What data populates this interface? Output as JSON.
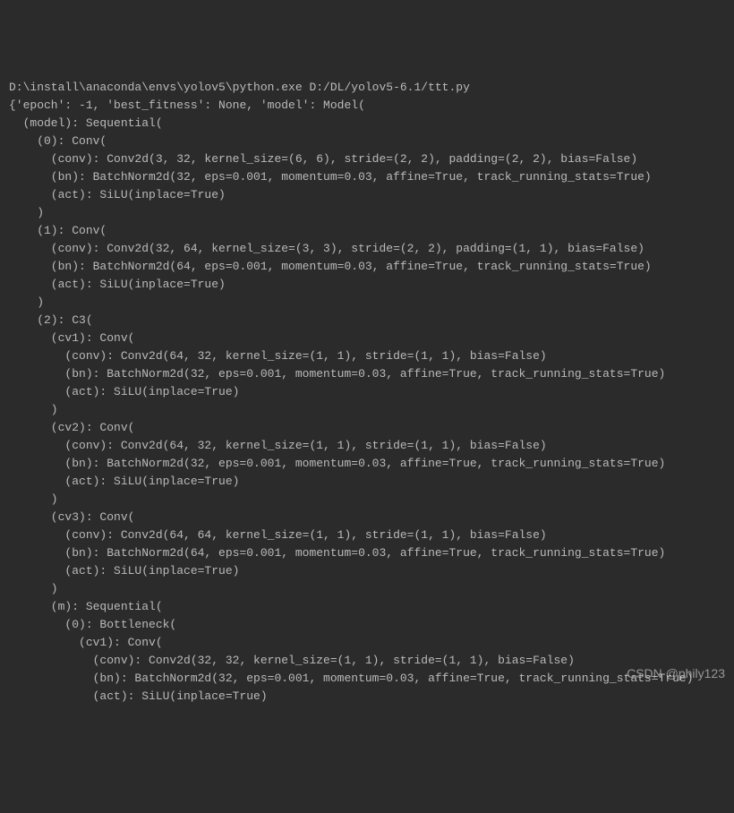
{
  "lines": [
    "D:\\install\\anaconda\\envs\\yolov5\\python.exe D:/DL/yolov5-6.1/ttt.py",
    "{'epoch': -1, 'best_fitness': None, 'model': Model(",
    "  (model): Sequential(",
    "    (0): Conv(",
    "      (conv): Conv2d(3, 32, kernel_size=(6, 6), stride=(2, 2), padding=(2, 2), bias=False)",
    "      (bn): BatchNorm2d(32, eps=0.001, momentum=0.03, affine=True, track_running_stats=True)",
    "      (act): SiLU(inplace=True)",
    "    )",
    "    (1): Conv(",
    "      (conv): Conv2d(32, 64, kernel_size=(3, 3), stride=(2, 2), padding=(1, 1), bias=False)",
    "      (bn): BatchNorm2d(64, eps=0.001, momentum=0.03, affine=True, track_running_stats=True)",
    "      (act): SiLU(inplace=True)",
    "    )",
    "    (2): C3(",
    "      (cv1): Conv(",
    "        (conv): Conv2d(64, 32, kernel_size=(1, 1), stride=(1, 1), bias=False)",
    "        (bn): BatchNorm2d(32, eps=0.001, momentum=0.03, affine=True, track_running_stats=True)",
    "        (act): SiLU(inplace=True)",
    "      )",
    "      (cv2): Conv(",
    "        (conv): Conv2d(64, 32, kernel_size=(1, 1), stride=(1, 1), bias=False)",
    "        (bn): BatchNorm2d(32, eps=0.001, momentum=0.03, affine=True, track_running_stats=True)",
    "        (act): SiLU(inplace=True)",
    "      )",
    "      (cv3): Conv(",
    "        (conv): Conv2d(64, 64, kernel_size=(1, 1), stride=(1, 1), bias=False)",
    "        (bn): BatchNorm2d(64, eps=0.001, momentum=0.03, affine=True, track_running_stats=True)",
    "        (act): SiLU(inplace=True)",
    "      )",
    "      (m): Sequential(",
    "        (0): Bottleneck(",
    "          (cv1): Conv(",
    "            (conv): Conv2d(32, 32, kernel_size=(1, 1), stride=(1, 1), bias=False)",
    "            (bn): BatchNorm2d(32, eps=0.001, momentum=0.03, affine=True, track_running_stats=True)",
    "            (act): SiLU(inplace=True)"
  ],
  "watermark": "CSDN @phily123"
}
